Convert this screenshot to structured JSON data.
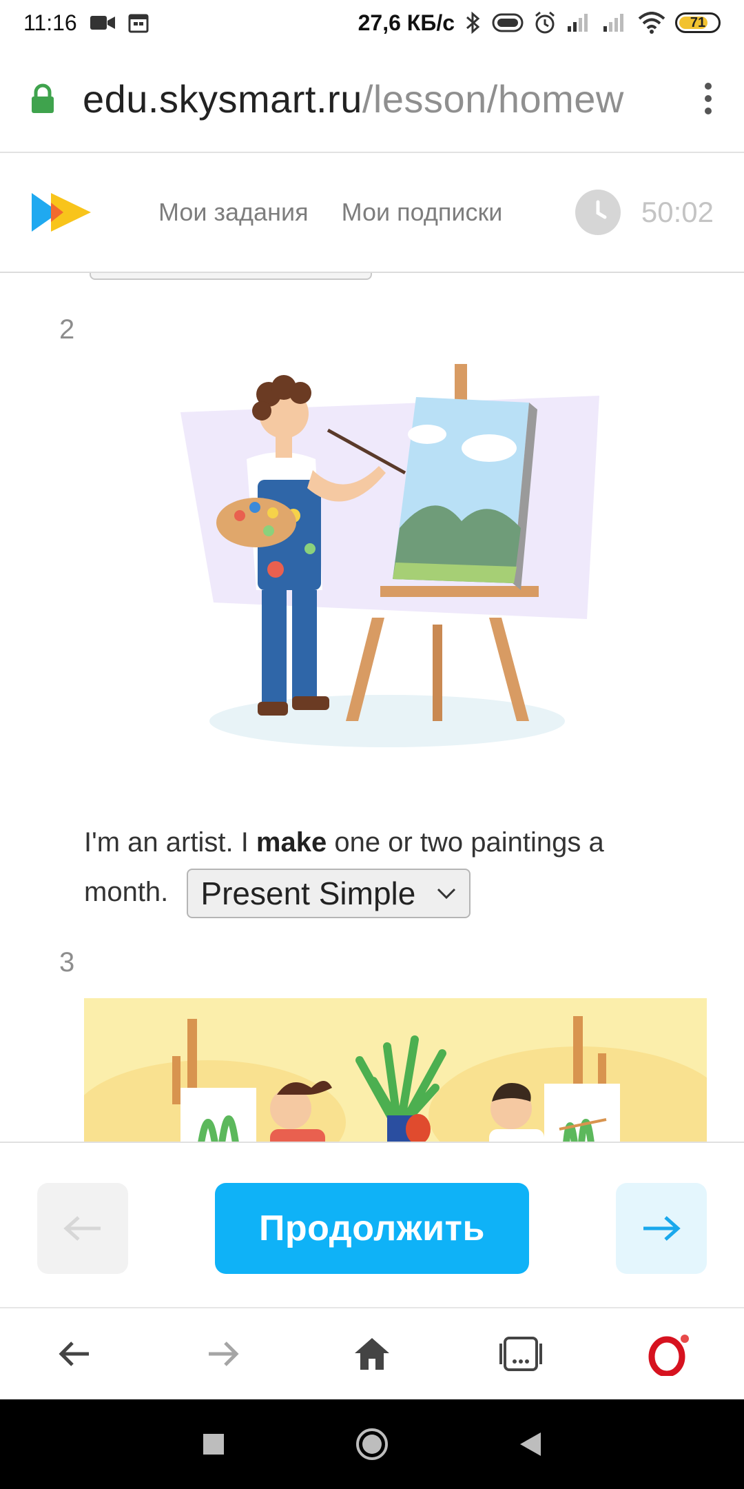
{
  "status_bar": {
    "time": "11:16",
    "network_speed": "27,6 КБ/с",
    "battery_level": "71"
  },
  "url_bar": {
    "host": "edu.skysmart.ru",
    "path": "/lesson/homew"
  },
  "site_header": {
    "nav": [
      "Мои задания",
      "Мои подписки"
    ],
    "timer": "50:02"
  },
  "questions": [
    {
      "number": "2",
      "sentence_before": "I'm an artist. I ",
      "sentence_bold": "make",
      "sentence_after": " one or two paintings a month.",
      "select_value": "Present Simple"
    },
    {
      "number": "3"
    }
  ],
  "action_bar": {
    "continue_label": "Продолжить"
  },
  "colors": {
    "accent": "#0fb2f7",
    "battery": "#f2c230",
    "lock": "#3fa34d"
  }
}
